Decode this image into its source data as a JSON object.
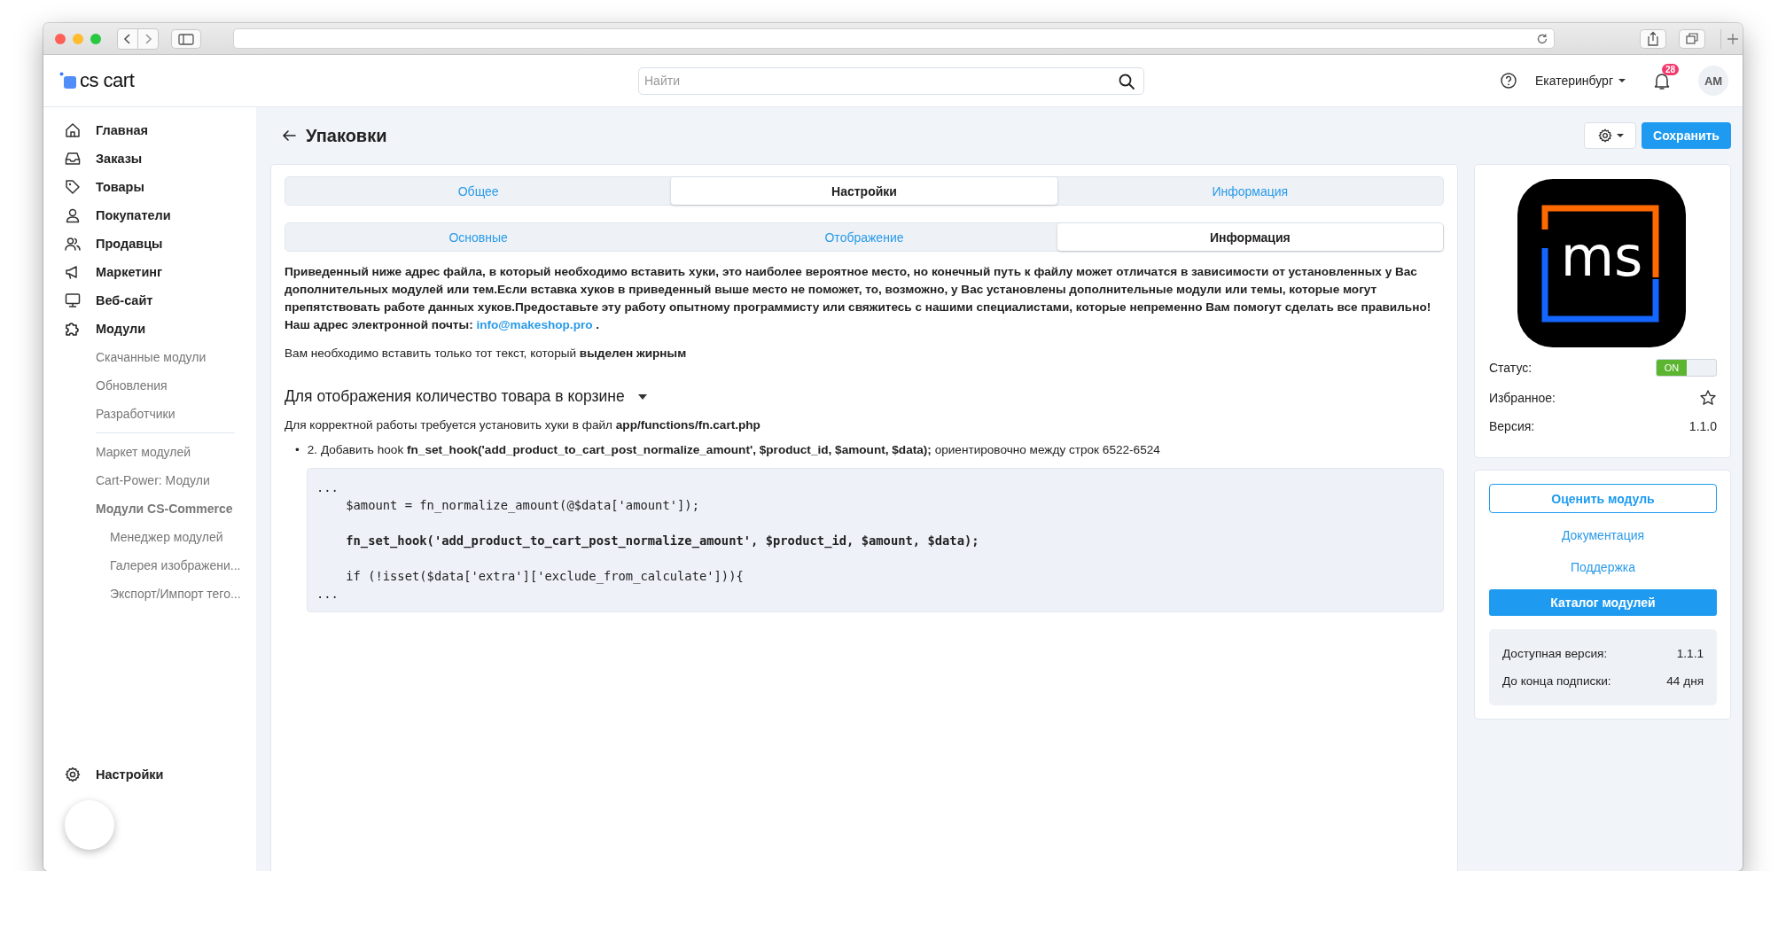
{
  "header": {
    "logo_text": "cs cart",
    "search": {
      "placeholder": "Найти"
    },
    "location": "Екатеринбург",
    "notifications": "28",
    "avatar": "AM"
  },
  "sidebar": {
    "items": [
      {
        "label": "Главная"
      },
      {
        "label": "Заказы"
      },
      {
        "label": "Товары"
      },
      {
        "label": "Покупатели"
      },
      {
        "label": "Продавцы"
      },
      {
        "label": "Маркетинг"
      },
      {
        "label": "Веб-сайт"
      },
      {
        "label": "Модули",
        "children": [
          {
            "label": "Скачанные модули"
          },
          {
            "label": "Обновления"
          },
          {
            "label": "Разработчики"
          }
        ]
      }
    ],
    "addon_links": [
      {
        "label": "Маркет модулей"
      },
      {
        "label": "Cart-Power: Модули"
      },
      {
        "label": "Модули CS-Commerce",
        "expanded": true,
        "children": [
          {
            "label": "Менеджер модулей"
          },
          {
            "label": "Галерея изображени..."
          },
          {
            "label": "Экспорт/Импорт тего..."
          }
        ]
      }
    ],
    "bottom_item": {
      "label": "Настройки"
    }
  },
  "page": {
    "title": "Упаковки",
    "save_button": "Сохранить"
  },
  "tabs": [
    {
      "label": "Общее",
      "selected": false
    },
    {
      "label": "Настройки",
      "selected": true
    },
    {
      "label": "Информация",
      "selected": false
    }
  ],
  "subtabs": [
    {
      "label": "Основные",
      "selected": false
    },
    {
      "label": "Отображение",
      "selected": false
    },
    {
      "label": "Информация",
      "selected": true
    }
  ],
  "intro": {
    "text": "Приведенный ниже адрес файла, в который необходимо вставить хуки, это наиболее вероятное место, но конечный путь к файлу может отличатся в зависимости от установленных у Вас дополнительных модулей или тем.Если вставка хуков в приведенный выше место не поможет, то, возможно, у Вас установлены дополнительные модули или темы, которые могут препятствовать работе данных хуков.Предоставьте эту работу опытному программисту или свяжитесь с нашими специалистами, которые непременно Вам помогут сделать все правильно! Наш адрес электронной почты: ",
    "email": "info@makeshop.pro",
    "tail": " ."
  },
  "notice": "Вам необходимо вставить только тот текст, который **выделен жирным**",
  "section": {
    "title": "Для отображения количество товара в корзине",
    "expanded": true,
    "note": "Для корректной работы требуется установить хуки в файл **app/functions/fn.cart.php**",
    "steps": [
      {
        "marker": "•",
        "text": "2. Добавить hook **fn_set_hook('add_product_to_cart_post_normalize_amount', $product_id, $amount, $data);** ориентировочно между строк 6522-6524"
      }
    ],
    "code_lines": [
      {
        "text": "...",
        "bold": false,
        "blank_before": false
      },
      {
        "text": "    $amount = fn_normalize_amount(@$data['amount']);",
        "bold": false,
        "blank_before": false
      },
      {
        "text": "    fn_set_hook('add_product_to_cart_post_normalize_amount', $product_id, $amount, $data);",
        "bold": true,
        "blank_before": true
      },
      {
        "text": "    if (!isset($data['extra']['exclude_from_calculate'])){",
        "bold": false,
        "blank_before": true
      },
      {
        "text": "...",
        "bold": false,
        "blank_before": false
      }
    ]
  },
  "module": {
    "logo_text": "ms",
    "rows": [
      {
        "label": "Статус:",
        "kind": "toggle",
        "on": true,
        "value": "ON"
      },
      {
        "label": "Избранное:",
        "kind": "star",
        "favorite": false
      },
      {
        "label": "Версия:",
        "kind": "text",
        "value": "1.1.0"
      }
    ]
  },
  "actions": {
    "rate_button": "Оценить модуль",
    "links": [
      "Документация",
      "Поддержка"
    ],
    "catalog_button": "Каталог модулей",
    "info": [
      {
        "label": "Доступная версия:",
        "value": "1.1.1"
      },
      {
        "label": "До конца подписки:",
        "value": "44 дня"
      }
    ]
  }
}
